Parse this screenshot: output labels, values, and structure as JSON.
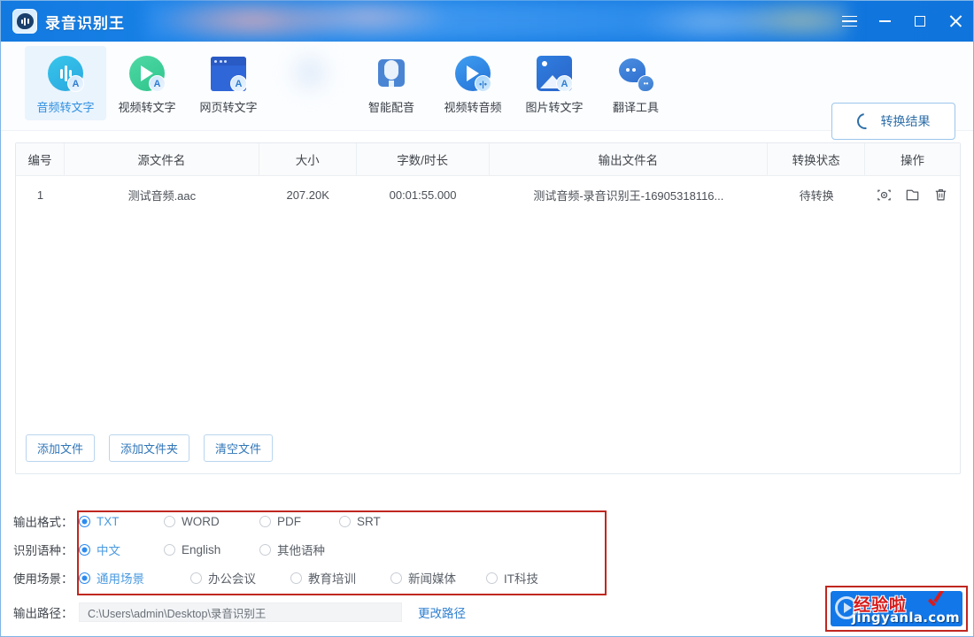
{
  "window": {
    "app_title": "录音识别王",
    "logo_icon": "speech-bubble-waveform-icon",
    "controls": {
      "menu": "hamburger-menu-icon",
      "minimize": "minimize-icon",
      "maximize": "maximize-icon",
      "close": "close-icon"
    }
  },
  "toolbar": {
    "items": [
      {
        "label": "音频转文字",
        "icon": "audio-to-text-icon",
        "active": true,
        "blurred": false
      },
      {
        "label": "视频转文字",
        "icon": "video-to-text-icon",
        "active": false,
        "blurred": false
      },
      {
        "label": "网页转文字",
        "icon": "web-to-text-icon",
        "active": false,
        "blurred": false
      },
      {
        "label": "",
        "icon": "blurred-icon",
        "active": false,
        "blurred": true
      },
      {
        "label": "智能配音",
        "icon": "smart-dubbing-icon",
        "active": false,
        "blurred": false
      },
      {
        "label": "视频转音频",
        "icon": "video-to-audio-icon",
        "active": false,
        "blurred": false
      },
      {
        "label": "图片转文字",
        "icon": "image-to-text-icon",
        "active": false,
        "blurred": false
      },
      {
        "label": "翻译工具",
        "icon": "translate-tool-icon",
        "active": false,
        "blurred": false
      }
    ],
    "result_button": {
      "label": "转换结果",
      "icon": "refresh-circle-icon"
    }
  },
  "table": {
    "headers": [
      "编号",
      "源文件名",
      "大小",
      "字数/时长",
      "输出文件名",
      "转换状态",
      "操作"
    ],
    "rows": [
      {
        "index": "1",
        "source_name": "测试音频.aac",
        "size": "207.20K",
        "duration": "00:01:55.000",
        "output_name": "测试音频-录音识别王-16905318116...",
        "status": "待转换",
        "actions": [
          "preview-icon",
          "open-folder-icon",
          "delete-icon"
        ]
      }
    ]
  },
  "panel_buttons": [
    {
      "label": "添加文件"
    },
    {
      "label": "添加文件夹"
    },
    {
      "label": "清空文件"
    }
  ],
  "options": {
    "format": {
      "label": "输出格式：",
      "choices": [
        {
          "label": "TXT",
          "selected": true
        },
        {
          "label": "WORD",
          "selected": false
        },
        {
          "label": "PDF",
          "selected": false
        },
        {
          "label": "SRT",
          "selected": false
        }
      ]
    },
    "language": {
      "label": "识别语种：",
      "choices": [
        {
          "label": "中文",
          "selected": true
        },
        {
          "label": "English",
          "selected": false
        },
        {
          "label": "其他语种",
          "selected": false
        }
      ]
    },
    "scene": {
      "label": "使用场景：",
      "choices": [
        {
          "label": "通用场景",
          "selected": true
        },
        {
          "label": "办公会议",
          "selected": false
        },
        {
          "label": "教育培训",
          "selected": false
        },
        {
          "label": "新闻媒体",
          "selected": false
        },
        {
          "label": "IT科技",
          "selected": false
        }
      ]
    },
    "output_path": {
      "label": "输出路径：",
      "value": "C:\\Users\\admin\\Desktop\\录音识别王",
      "change_link": "更改路径"
    }
  },
  "watermark": {
    "main": "经验啦",
    "sub": "jingyanla.com",
    "check_icon": "red-check-icon",
    "play_icon": "play-circle-icon"
  },
  "colors": {
    "brand_blue": "#1277e8",
    "accent_blue": "#2d8cf0",
    "highlight_red": "#c0271f",
    "active_tab_bg": "#eaf4fd"
  }
}
